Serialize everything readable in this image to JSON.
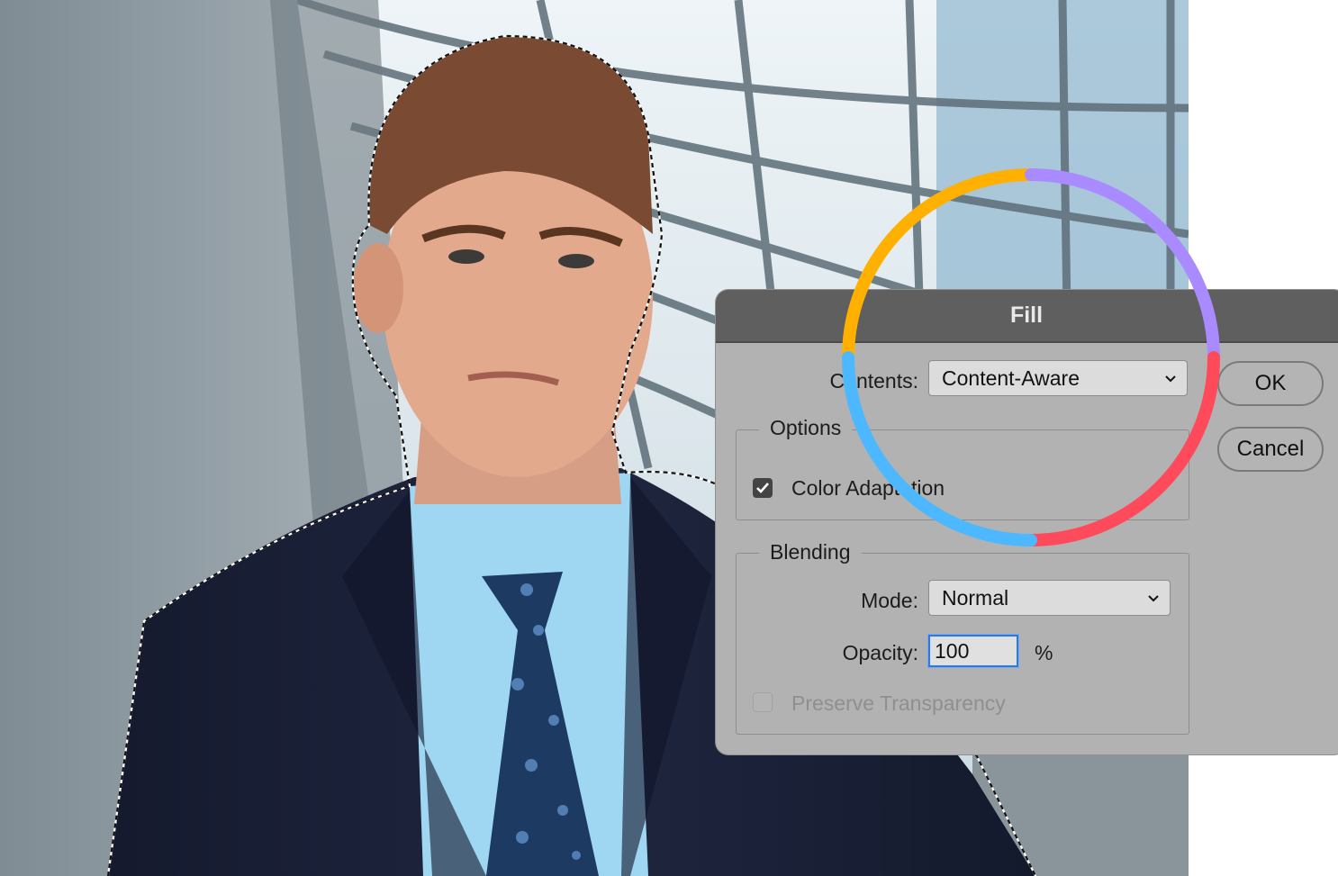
{
  "dialog": {
    "title": "Fill",
    "contents_label": "Contents:",
    "contents_value": "Content-Aware",
    "options_title": "Options",
    "color_adaptation_label": "Color Adaptation",
    "color_adaptation_checked": true,
    "blending_title": "Blending",
    "mode_label": "Mode:",
    "mode_value": "Normal",
    "opacity_label": "Opacity:",
    "opacity_value": "100",
    "opacity_unit": "%",
    "preserve_transparency_label": "Preserve Transparency",
    "preserve_transparency_checked": false,
    "ok_label": "OK",
    "cancel_label": "Cancel"
  },
  "overlay_ring": {
    "colors": [
      "#FFB000",
      "#A98BFF",
      "#FF4A5C",
      "#4DB8FF"
    ]
  },
  "icons": [
    "chevron-down-icon",
    "checkmark-icon"
  ]
}
